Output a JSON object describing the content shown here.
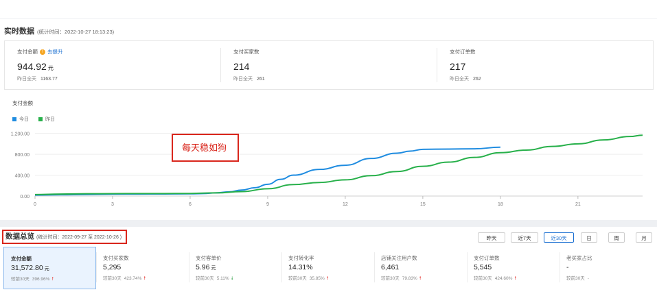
{
  "realtime": {
    "title": "实时数据",
    "stat_time": "(统计时间：2022-10-27 18:13:23)",
    "metrics": [
      {
        "label": "支付金额",
        "value": "944.92",
        "unit": "元",
        "yest_label": "昨日全天",
        "yest_value": "1163.77",
        "link": "去提升"
      },
      {
        "label": "支付买家数",
        "value": "214",
        "unit": "",
        "yest_label": "昨日全天",
        "yest_value": "261"
      },
      {
        "label": "支付订单数",
        "value": "217",
        "unit": "",
        "yest_label": "昨日全天",
        "yest_value": "262"
      }
    ]
  },
  "chart_title": "支付金额",
  "legend": {
    "today": "今日",
    "yesterday": "昨日"
  },
  "annotation": "每天稳如狗",
  "colors": {
    "today": "#1f8ce0",
    "yesterday": "#27b04a",
    "accent": "#1a6fd1",
    "alert": "#d9261c"
  },
  "chart_data": {
    "type": "line",
    "title": "支付金额",
    "xlim": [
      0,
      23.5
    ],
    "ylim": [
      0,
      1300
    ],
    "x_ticks": [
      "0",
      "3",
      "6",
      "9",
      "12",
      "15",
      "18",
      "21"
    ],
    "y_ticks": [
      "0.00",
      "400.00",
      "800.00",
      "1,200.00"
    ],
    "grid": "horizontal",
    "legend_position": "top-left",
    "series": [
      {
        "name": "今日",
        "x": [
          0,
          1,
          2,
          3,
          4,
          5,
          6,
          6.5,
          7,
          7.5,
          8,
          8.5,
          9,
          9.5,
          10,
          11,
          12,
          13,
          14,
          14.5,
          15,
          16,
          17,
          18
        ],
        "y": [
          18,
          24,
          30,
          36,
          38,
          40,
          42,
          48,
          60,
          80,
          115,
          160,
          225,
          320,
          400,
          510,
          590,
          720,
          820,
          860,
          895,
          900,
          905,
          935
        ]
      },
      {
        "name": "昨日",
        "x": [
          0,
          1,
          2,
          3,
          4,
          5,
          6,
          7,
          8,
          9,
          10,
          11,
          12,
          13,
          14,
          15,
          16,
          17,
          18,
          19,
          20,
          21,
          22,
          23,
          23.5
        ],
        "y": [
          28,
          38,
          44,
          46,
          48,
          48,
          50,
          60,
          85,
          140,
          220,
          260,
          310,
          390,
          470,
          570,
          650,
          740,
          830,
          880,
          950,
          1000,
          1075,
          1140,
          1165
        ]
      }
    ]
  },
  "overview": {
    "title": "数据总览",
    "stat_range": "(统计时间：2022-09-27 至 2022-10-26 )",
    "ranges": [
      {
        "label": "昨天",
        "active": false
      },
      {
        "label": "近7天",
        "active": false
      },
      {
        "label": "近30天",
        "active": true
      },
      {
        "label": "日",
        "active": false
      },
      {
        "label": "周",
        "active": false
      },
      {
        "label": "月",
        "active": false
      }
    ],
    "cards": [
      {
        "label": "支付金额",
        "value": "31,572.80",
        "unit": "元",
        "cmp": "较前30天",
        "pct": "396.96%",
        "trend": "up"
      },
      {
        "label": "支付买家数",
        "value": "5,295",
        "unit": "",
        "cmp": "较前30天",
        "pct": "423.74%",
        "trend": "up"
      },
      {
        "label": "支付客单价",
        "value": "5.96",
        "unit": "元",
        "cmp": "较前30天",
        "pct": "5.11%",
        "trend": "down"
      },
      {
        "label": "支付转化率",
        "value": "14.31%",
        "unit": "",
        "cmp": "较前30天",
        "pct": "35.85%",
        "trend": "up"
      },
      {
        "label": "店铺关注用户数",
        "value": "6,461",
        "unit": "",
        "cmp": "较前30天",
        "pct": "79.83%",
        "trend": "up"
      },
      {
        "label": "支付订单数",
        "value": "5,545",
        "unit": "",
        "cmp": "较前30天",
        "pct": "424.60%",
        "trend": "up"
      },
      {
        "label": "老买家占比",
        "value": "-",
        "unit": "",
        "cmp": "较前30天",
        "pct": "-",
        "trend": ""
      }
    ]
  }
}
